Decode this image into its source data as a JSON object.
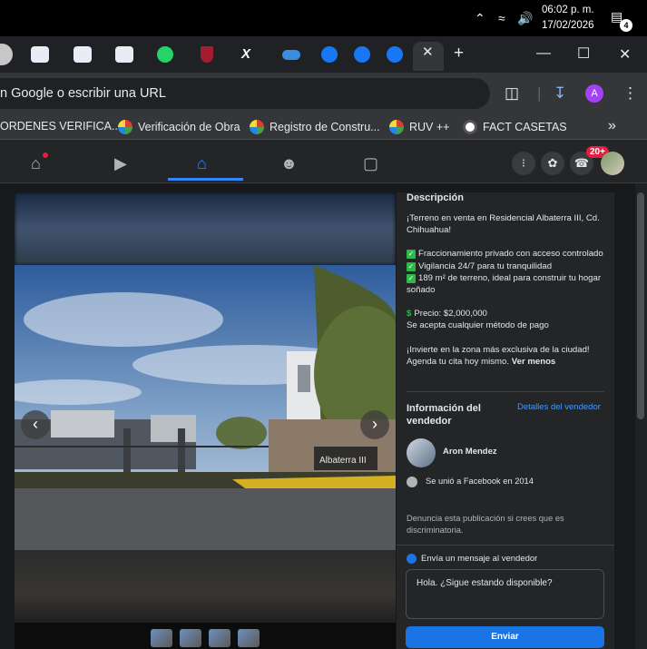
{
  "taskbar": {
    "time": "06:02 p. m.",
    "date": "17/02/2026",
    "notifications_count": "4"
  },
  "browser": {
    "omnibox_text": "n Google o escribir una URL",
    "profile_initial": "A",
    "bookmarks": [
      {
        "label": "ORDENES VERIFICA...",
        "icon": "bookmark-icon"
      },
      {
        "label": "Verificación de Obra",
        "icon": "ruv-icon"
      },
      {
        "label": "Registro de Constru...",
        "icon": "ruv-icon"
      },
      {
        "label": "RUV ++",
        "icon": "ruv-icon"
      },
      {
        "label": "FACT CASETAS",
        "icon": "globe-icon"
      }
    ],
    "more_bookmarks": "»"
  },
  "facebook": {
    "notification_badge": "20+",
    "description": {
      "title": "Descripción",
      "intro": "¡Terreno en venta en Residencial Albaterra III, Cd. Chihuahua!",
      "bullets": [
        "Fraccionamiento privado con acceso controlado",
        "Vigilancia 24/7 para tu tranquilidad",
        "189 m² de terreno, ideal para construir tu hogar soñado"
      ],
      "price_label": "Precio: $2,000,000",
      "payment": "Se acepta cualquier método de pago",
      "cta": "¡Invierte en la zona más exclusiva de la ciudad! Agenda tu cita hoy mismo.",
      "see_less": "Ver menos"
    },
    "seller": {
      "title": "Información del vendedor",
      "details_link": "Detalles del vendedor",
      "name": "Aron Mendez",
      "joined": "Se unió a Facebook en 2014"
    },
    "report_text": "Denuncia esta publicación si crees que es discriminatoria.",
    "message": {
      "header": "Envía un mensaje al vendedor",
      "input_value": "Hola. ¿Sigue estando disponible?",
      "send_label": "Enviar"
    },
    "photo_sign": "Albaterra III"
  }
}
